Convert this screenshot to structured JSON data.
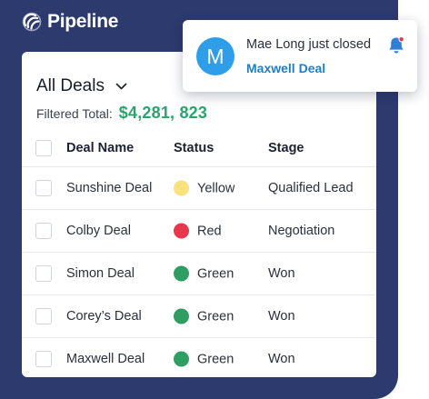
{
  "app": {
    "name": "Pipeline"
  },
  "deals": {
    "filter_label": "All Deals",
    "total_label": "Filtered Total:",
    "total_value": "$4,281, 823",
    "columns": {
      "name": "Deal Name",
      "status": "Status",
      "stage": "Stage"
    },
    "rows": [
      {
        "name": "Sunshine Deal",
        "status": "Yellow",
        "status_color": "#f9e27d",
        "stage": "Qualified Lead"
      },
      {
        "name": "Colby Deal",
        "status": "Red",
        "status_color": "#e8364a",
        "stage": "Negotiation"
      },
      {
        "name": "Simon Deal",
        "status": "Green",
        "status_color": "#2f9e62",
        "stage": "Won"
      },
      {
        "name": "Corey’s Deal",
        "status": "Green",
        "status_color": "#2f9e62",
        "stage": "Won"
      },
      {
        "name": "Maxwell Deal",
        "status": "Green",
        "status_color": "#2f9e62",
        "stage": "Won"
      }
    ]
  },
  "notification": {
    "avatar_initial": "M",
    "message": "Mae Long just closed",
    "link": "Maxwell Deal",
    "icon": "bell-icon"
  },
  "colors": {
    "frame": "#2c3a6e",
    "total_green": "#2aa36d",
    "link_blue": "#1f7fc7",
    "avatar_blue": "#2f9ee9",
    "bell_blue": "#2f7fd6",
    "bell_badge": "#e8364a"
  }
}
